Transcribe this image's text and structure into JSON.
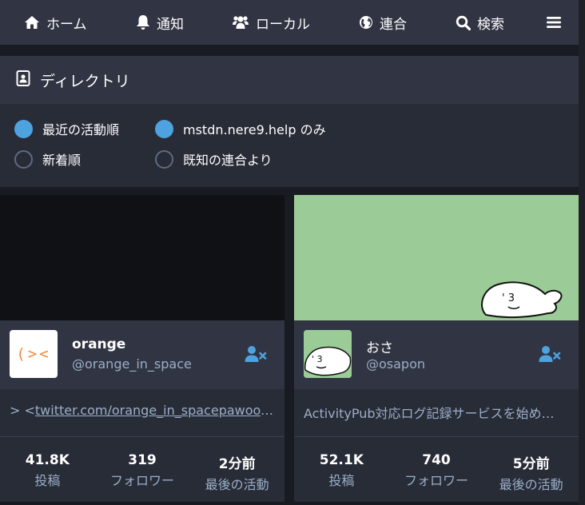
{
  "nav": {
    "home": "ホーム",
    "notifications": "通知",
    "local": "ローカル",
    "federated": "連合",
    "search": "検索"
  },
  "directory": {
    "title": "ディレクトリ",
    "options": {
      "recent_active": "最近の活動順",
      "new_arrivals": "新着順",
      "local_only": "mstdn.nere9.help のみ",
      "from_federation": "既知の連合より"
    },
    "selected": [
      "recent_active",
      "local_only"
    ]
  },
  "cards": [
    {
      "name": "orange",
      "handle": "@orange_in_space",
      "avatar_text": "(><",
      "bio_prefix": "> <",
      "bio_link": "twitter.com/orange_in_spacepawoo.…",
      "stats": [
        {
          "value": "41.8K",
          "label": "投稿"
        },
        {
          "value": "319",
          "label": "フォロワー"
        },
        {
          "value": "2分前",
          "label": "最後の活動"
        }
      ]
    },
    {
      "name": "おさ",
      "handle": "@osapon",
      "bio": "ActivityPub対応ログ記録サービスを始め…",
      "stats": [
        {
          "value": "52.1K",
          "label": "投稿"
        },
        {
          "value": "740",
          "label": "フォロワー"
        },
        {
          "value": "5分前",
          "label": "最後の活動"
        }
      ]
    }
  ],
  "colors": {
    "background": "#191b22",
    "panel": "#313543",
    "panel_dark": "#282c37",
    "accent": "#4ea2df",
    "secondary_text": "#9baec8",
    "banner_green": "#9bcb96"
  },
  "icons": [
    "home-icon",
    "bell-icon",
    "users-icon",
    "globe-icon",
    "search-icon",
    "menu-icon",
    "address-book-icon",
    "user-times-icon"
  ]
}
